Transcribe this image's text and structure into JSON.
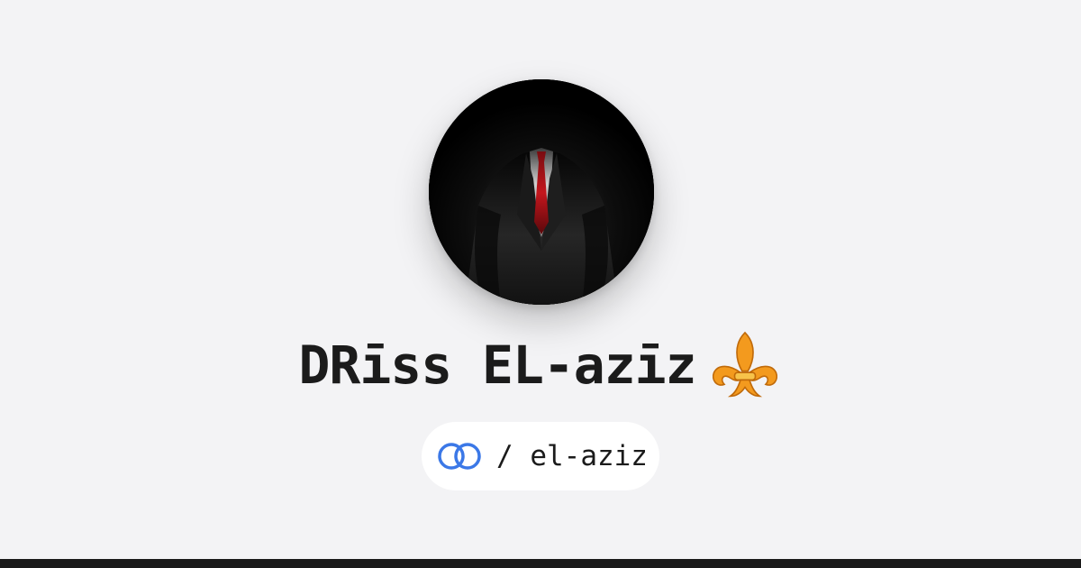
{
  "profile": {
    "display_name": "DRīss EL-azīz",
    "name_emoji": "fleur-de-lis-icon",
    "handle": "/ el-aziz",
    "platform_logo": "linked-rings-icon",
    "avatar": "avatar-suit-red-tie"
  },
  "colors": {
    "background": "#f3f3f5",
    "pill_background": "#ffffff",
    "text": "#1b1b1b",
    "logo_blue": "#3b78e7",
    "footer": "#1a1a1a",
    "tie_red": "#b5151b",
    "emoji_orange": "#f39a1e"
  }
}
